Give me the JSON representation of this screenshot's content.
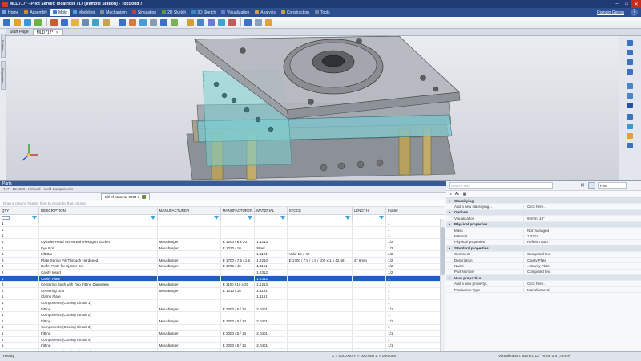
{
  "window": {
    "title": "MLD717* - Pilot Server: localhost 717 (Remote Station) - TopSolid 7"
  },
  "menubar": {
    "tabs": [
      {
        "label": "Home",
        "color": "#7aa6de"
      },
      {
        "label": "Assembly",
        "color": "#d08a3c"
      },
      {
        "label": "Mold",
        "color": "#3e7bd2"
      },
      {
        "label": "Modeling",
        "color": "#5aa0d6"
      },
      {
        "label": "Mechanism",
        "color": "#8d8d8d"
      },
      {
        "label": "Simulation",
        "color": "#c23f3f"
      },
      {
        "label": "2D Sketch",
        "color": "#5b9b3c"
      },
      {
        "label": "3D Sketch",
        "color": "#3a87c9"
      },
      {
        "label": "Visualization",
        "color": "#6a7ad0"
      },
      {
        "label": "Analysis",
        "color": "#d0a23c"
      },
      {
        "label": "Construction",
        "color": "#c8a43a"
      },
      {
        "label": "Tools",
        "color": "#7b8797"
      }
    ],
    "active_index": 2,
    "user": "Romain Gerton"
  },
  "toolbar": {
    "icons": [
      "mold-base-icon",
      "cavity-icon",
      "core-icon",
      "parting-icon",
      "insert-icon",
      "slider-icon",
      "lifter-icon",
      "ejector-icon",
      "cooling-icon",
      "gate-icon",
      "runner-icon",
      "sprue-icon",
      "locating-ring-icon",
      "screw-icon",
      "dowel-icon",
      "spring-icon",
      "plate-icon",
      "pocket-icon",
      "drill-icon",
      "hole-icon",
      "thread-icon",
      "check-icon",
      "measure-icon",
      "analysis-icon"
    ],
    "colors": [
      "#3b73c4",
      "#e2a23a",
      "#3b9ad6",
      "#6bb04a",
      "#c85a3a",
      "#3b73c4",
      "#e0b83f",
      "#6f8ab0",
      "#3fa3c9",
      "#c4a35a",
      "#3b73c4",
      "#d77b3a",
      "#4a9bd1",
      "#8c9cb0",
      "#3b73c4",
      "#7bb05a",
      "#d0a040",
      "#4a86c8",
      "#6a7bd1",
      "#3fa3c9",
      "#c45a5a",
      "#3b73c4",
      "#8aa0c0",
      "#e2a23a"
    ]
  },
  "left_strip": {
    "tabs": [
      "Entities",
      "Properties"
    ]
  },
  "doc_tabs": [
    {
      "label": "Start Page",
      "active": false
    },
    {
      "label": "MLD717*",
      "active": true
    }
  ],
  "viewport": {
    "scale_label": "12mm"
  },
  "parts_panel": {
    "title": "Parts",
    "breadcrumb": "717 - 12A003 - Kirkwall - Mold Components",
    "sub_tabs": [
      {
        "label": "Bill of Material 0034 1",
        "active": true
      }
    ],
    "group_by_hint": "Drag a column header here to group by that column",
    "columns": [
      "QTY",
      "DESCRIPTION",
      "MANUFACTURER",
      "MANUFACTURER...",
      "MATERIAL",
      "STOCK",
      "LENGTH",
      "Folder"
    ],
    "rows": [
      [
        "1",
        "",
        "",
        "",
        "",
        "",
        "",
        "1"
      ],
      [
        "1",
        "",
        "",
        "",
        "",
        "",
        "",
        "1"
      ],
      [
        "1",
        "",
        "",
        "",
        "",
        "",
        "",
        "1"
      ],
      [
        "4",
        "Cylinder Head Screw with Hexagon Socket",
        "Meusburger",
        "E 1200 / 8 x 20",
        "1.1213",
        "",
        "",
        "1/2"
      ],
      [
        "1",
        "Eye Bolt",
        "Meusburger",
        "E 1320 / 10",
        "Steel",
        "",
        "",
        "1/2"
      ],
      [
        "1",
        "Lift Bar",
        "",
        "",
        "1.1191",
        "Valid 15 x 42",
        "",
        "1/2"
      ],
      [
        "8",
        "Plate Spring Pin Through Hardened",
        "Meusburger",
        "E 1700 / 7.5 / 1.5",
        "1.2210",
        "E 1700 / 7.5 / 1.5 / 100 x 1 x 42.58",
        "47.6mm",
        "1/2"
      ],
      [
        "4",
        "Buffer Plate for Ejector Set",
        "Meusburger",
        "E 1709 / 42",
        "1.1191",
        "",
        "",
        "1/2"
      ],
      [
        "2",
        "Cavity Insert",
        "",
        "",
        "1.2312",
        "",
        "",
        "1/2"
      ],
      [
        "1",
        "Cavity Plate",
        "",
        "",
        "1.2312",
        "",
        "",
        "1"
      ],
      [
        "4",
        "Centering Bush with Two Fitting Diameters",
        "Meusburger",
        "E 1100 / 10 x 30",
        "1.1213",
        "",
        "",
        "1"
      ],
      [
        "2",
        "Centering Unit",
        "Meusburger",
        "E 1310 / 16",
        "1.1191",
        "",
        "",
        "1"
      ],
      [
        "1",
        "Clamp Plate",
        "",
        "",
        "1.1191",
        "",
        "",
        "1"
      ],
      [
        "1",
        "Components (Cooling Circuit 1)",
        "",
        "",
        "",
        "",
        "",
        "1"
      ],
      [
        "1",
        "Fitting",
        "Meusburger",
        "E 2000 / 5 / 14",
        "2.0401",
        "",
        "",
        "1/1"
      ],
      [
        "1",
        "Components (Cooling Circuit 2)",
        "",
        "",
        "",
        "",
        "",
        "1"
      ],
      [
        "1",
        "Fitting",
        "Meusburger",
        "E 2000 / 5 / 14",
        "2.0401",
        "",
        "",
        "1/1"
      ],
      [
        "1",
        "Components (Cooling Circuit 3)",
        "",
        "",
        "",
        "",
        "",
        "1"
      ],
      [
        "1",
        "Fitting",
        "Meusburger",
        "E 2000 / 5 / 14",
        "2.0401",
        "",
        "",
        "1/1"
      ],
      [
        "1",
        "Components (Cooling Circuit 4)",
        "",
        "",
        "",
        "",
        "",
        "1"
      ],
      [
        "1",
        "Fitting",
        "Meusburger",
        "E 2000 / 5 / 14",
        "2.0401",
        "",
        "",
        "1/1"
      ],
      [
        "1",
        "Components (Cooling Circuit 5)",
        "",
        "",
        "",
        "",
        "",
        "1"
      ]
    ],
    "selected_row": 9
  },
  "properties": {
    "search_placeholder": "Search text",
    "filter_value": "Find",
    "toolbar": [
      "≡",
      "A↓",
      "▦"
    ],
    "rows": [
      {
        "kind": "cat",
        "name": "Classifying"
      },
      {
        "kind": "prop",
        "name": "Add a new classifying...",
        "value": "Click here..."
      },
      {
        "kind": "cat",
        "name": "Options"
      },
      {
        "kind": "prop",
        "name": "Visualization",
        "value": "92mm, 13°"
      },
      {
        "kind": "cat",
        "name": "Physical properties"
      },
      {
        "kind": "prop",
        "name": "Mass",
        "value": "Not managed"
      },
      {
        "kind": "prop",
        "name": "Material",
        "value": "1.2312"
      },
      {
        "kind": "prop",
        "name": "Physical properties",
        "value": "Refresh auto"
      },
      {
        "kind": "cat",
        "name": "Standard properties"
      },
      {
        "kind": "prop",
        "name": "Comment",
        "value": "Computed text"
      },
      {
        "kind": "prop",
        "name": "Description",
        "value": "Cavity Plate"
      },
      {
        "kind": "prop",
        "name": "Name",
        "value": "= Cavity Plate"
      },
      {
        "kind": "prop",
        "name": "Part Number",
        "value": "Computed text"
      },
      {
        "kind": "cat",
        "name": "User properties"
      },
      {
        "kind": "prop",
        "name": "Add a new property...",
        "value": "Click here..."
      },
      {
        "kind": "prop",
        "name": "Production Type",
        "value": "Manufactured"
      }
    ]
  },
  "status": {
    "left": "Ready",
    "coords": "X = 000.000   Y = 000.000   Z = 000.000",
    "visualization": "Visualization: 92mm, 13°   Area: 0,47,4mm²"
  }
}
